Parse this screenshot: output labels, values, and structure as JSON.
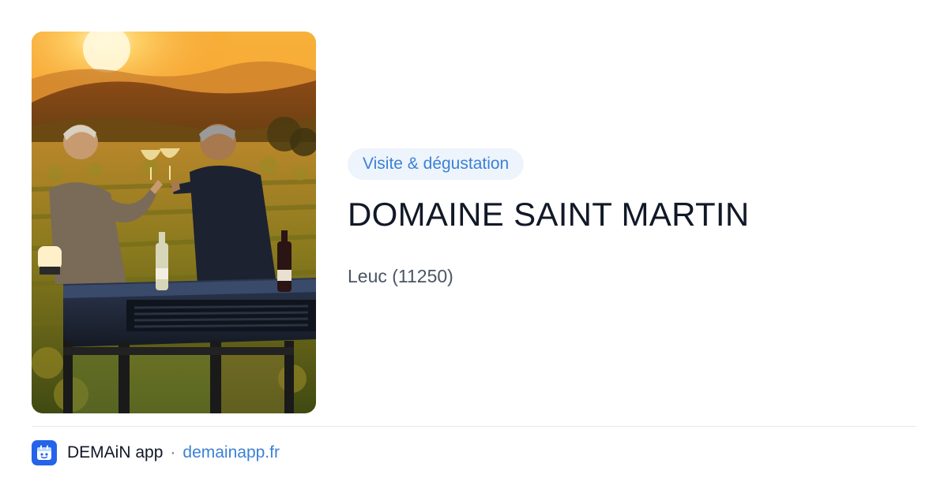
{
  "card": {
    "tag_label": "Visite & dégustation",
    "title": "DOMAINE SAINT MARTIN",
    "location": "Leuc (11250)",
    "image_alt": "Deux hommes trinquant avec du vin blanc sur un tracteur dans les vignes au coucher du soleil"
  },
  "footer": {
    "app_icon": "demain-app-icon",
    "app_name": "DEMAiN app",
    "separator": "·",
    "link_text": "demainapp.fr"
  },
  "colors": {
    "accent": "#3b82d6",
    "tag_background": "#eef4fc",
    "title": "#111827",
    "secondary_text": "#4b5563",
    "app_icon_background": "#2563eb"
  }
}
